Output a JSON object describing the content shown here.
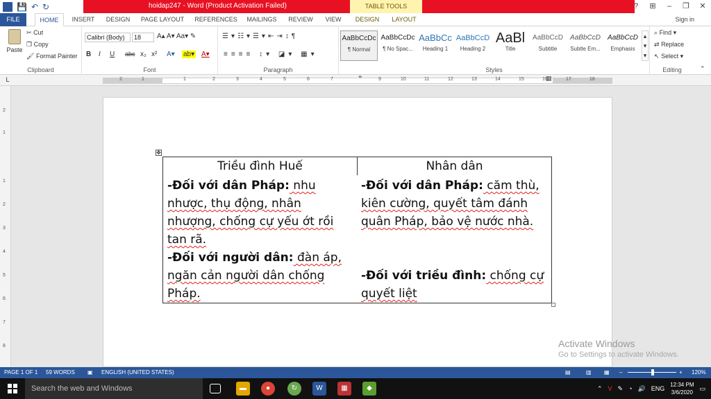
{
  "titlebar": {
    "title": "hoidap247 - Word (Product Activation Failed)",
    "context_tab": "TABLE TOOLS",
    "help": "?",
    "ribbon_display": "⊞",
    "minimize": "–",
    "restore": "❐",
    "close": "✕",
    "logo": "W",
    "save": "💾",
    "undo": "↶",
    "redo": "↻"
  },
  "tabs": [
    "FILE",
    "HOME",
    "INSERT",
    "DESIGN",
    "PAGE LAYOUT",
    "REFERENCES",
    "MAILINGS",
    "REVIEW",
    "VIEW",
    "DESIGN",
    "LAYOUT"
  ],
  "signin": "Sign in",
  "clipboard": {
    "label": "Clipboard",
    "paste": "Paste",
    "cut": "Cut",
    "copy": "Copy",
    "format_painter": "Format Painter"
  },
  "font": {
    "label": "Font",
    "name": "Calibri (Body)",
    "size": "18",
    "bold": "B",
    "italic": "I",
    "underline": "U",
    "strike": "abc",
    "subscript": "x₂",
    "superscript": "x²"
  },
  "paragraph": {
    "label": "Paragraph"
  },
  "styles": {
    "label": "Styles",
    "items": [
      {
        "sample": "AaBbCcDc",
        "name": "¶ Normal"
      },
      {
        "sample": "AaBbCcDc",
        "name": "¶ No Spac..."
      },
      {
        "sample": "AaBbCc",
        "name": "Heading 1"
      },
      {
        "sample": "AaBbCcD",
        "name": "Heading 2"
      },
      {
        "sample": "AaBl",
        "name": "Title"
      },
      {
        "sample": "AaBbCcD",
        "name": "Subtitle"
      },
      {
        "sample": "AaBbCcD",
        "name": "Subtle Em..."
      },
      {
        "sample": "AaBbCcD",
        "name": "Emphasis"
      }
    ]
  },
  "editing": {
    "label": "Editing",
    "find": "Find",
    "replace": "Replace",
    "select": "Select"
  },
  "ruler": {
    "numbers": [
      "2",
      "1",
      "1",
      "2",
      "3",
      "4",
      "5",
      "6",
      "7",
      "9",
      "10",
      "11",
      "12",
      "13",
      "14",
      "15",
      "16",
      "17",
      "18"
    ],
    "vnumbers": [
      "2",
      "1",
      "1",
      "2",
      "3",
      "4",
      "5",
      "6",
      "7",
      "8"
    ]
  },
  "table": {
    "header_left": "Triều đình Huế",
    "header_right": "Nhân dân",
    "left_p1_bold": "-Đối với dân Pháp:",
    "left_p1_text": " nhu nhược, thụ động, nhân nhượng, chống cự yếu ớt rồi tan rã.",
    "left_p2_bold": "-Đối với người dân:",
    "left_p2_text": " đàn áp, ngăn cản người dân chống Pháp.",
    "right_p1_bold": "-Đối với dân Pháp:",
    "right_p1_text": " căm thù, kiên cường, quyết tâm đánh quân Pháp, bảo vệ nước nhà.",
    "right_p2_bold": "-Đối với triều đình:",
    "right_p2_text": " chống cự quyết liệt"
  },
  "watermark": {
    "line1": "Activate Windows",
    "line2": "Go to Settings to activate Windows."
  },
  "statusbar": {
    "page": "PAGE 1 OF 1",
    "words": "59 WORDS",
    "language": "ENGLISH (UNITED STATES)",
    "zoom": "120%"
  },
  "taskbar": {
    "search_placeholder": "Search the web and Windows",
    "language": "ENG",
    "time": "12:34 PM",
    "date": "3/6/2020"
  },
  "colors": {
    "word_blue": "#2b579a",
    "titlebar_red": "#e81123",
    "table_tools": "#fff3b0"
  }
}
